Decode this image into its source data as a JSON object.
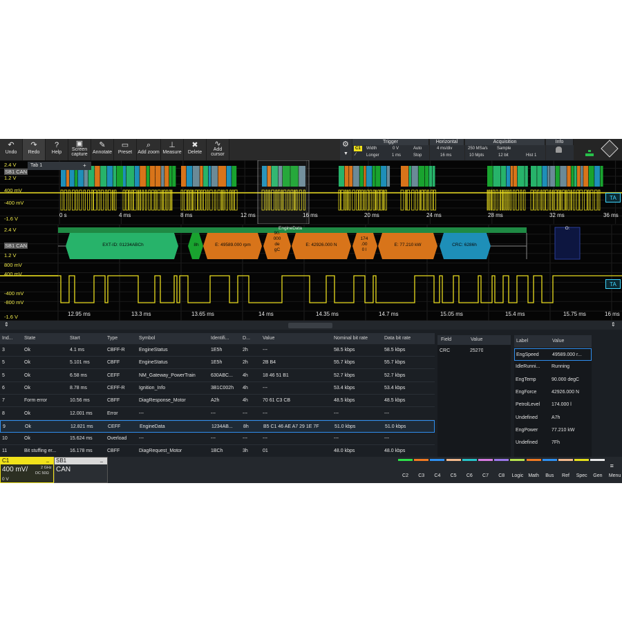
{
  "toolbar": {
    "buttons": [
      {
        "label": "Undo",
        "icon": "undo-icon",
        "glyph": "↶"
      },
      {
        "label": "Redo",
        "icon": "redo-icon",
        "glyph": "↷"
      },
      {
        "label": "Help",
        "icon": "help-icon",
        "glyph": "?"
      },
      {
        "label": "Screen\ncapture",
        "icon": "camera-icon",
        "glyph": "▣"
      },
      {
        "label": "Annotate",
        "icon": "pen-icon",
        "glyph": "✎"
      },
      {
        "label": "Preset",
        "icon": "preset-icon",
        "glyph": "▭"
      },
      {
        "label": "Add zoom",
        "icon": "zoom-icon",
        "glyph": "⌕"
      },
      {
        "label": "Measure",
        "icon": "measure-icon",
        "glyph": "⊥"
      },
      {
        "label": "Delete",
        "icon": "trash-icon",
        "glyph": "✖"
      },
      {
        "label": "Add\ncursor",
        "icon": "cursor-icon",
        "glyph": "∿"
      }
    ],
    "trigger": {
      "title": "Trigger",
      "badge": "C1",
      "row1": [
        "Width",
        "0 V",
        "Auto"
      ],
      "row2": [
        "Longer",
        "1 ms",
        "Stop"
      ]
    },
    "horizontal": {
      "title": "Horizontal",
      "row1": "4 ms/div",
      "row2": "16 ms"
    },
    "acquisition": {
      "title": "Acquisition",
      "row1": [
        "250 MSa/s",
        "Sample"
      ],
      "row2": [
        "10 Mpts",
        "12 bit",
        "Hist 1"
      ]
    },
    "info": {
      "title": "Info"
    }
  },
  "tab": {
    "label": "Tab 1",
    "add": "+"
  },
  "overview": {
    "labels": {
      "v1": "2.4 V",
      "ch": "SB1 CAN",
      "v2": "1.2 V",
      "v3": "400 mV",
      "v4": "-400 mV",
      "v5": "-1.6 V"
    },
    "times": [
      "0 s",
      "4 ms",
      "8 ms",
      "12 ms",
      "16 ms",
      "20 ms",
      "24 ms",
      "28 ms",
      "32 ms",
      "36 ms"
    ],
    "ta": "TA"
  },
  "zoom": {
    "labels": {
      "v1": "2.4 V",
      "ch": "SB1 CAN",
      "v2": "1.2 V",
      "v3": "800 mV",
      "v4": "400 mV",
      "v5": "-400 mV",
      "v6": "-800 mV",
      "v7": "-1.6 V"
    },
    "times": [
      "12.95 ms",
      "13.3 ms",
      "13.65 ms",
      "14 ms",
      "14.35 ms",
      "14.7 ms",
      "15.05 ms",
      "15.4 ms",
      "15.75 ms",
      "16 ms"
    ],
    "frame_title": "EngineData",
    "o_label": "O:",
    "fields": [
      {
        "text": "EXT-ID: 01234ABCh",
        "color": "#27b36a"
      },
      {
        "text": "8h",
        "color": "#19a32f"
      },
      {
        "text": "E: 49589.000 rpm",
        "color": "#d8741a"
      },
      {
        "text": "90.\n000\nde\ngC",
        "color": "#d8741a"
      },
      {
        "text": "E: 42926.000 N",
        "color": "#d8741a"
      },
      {
        "text": "174\n.00\n0 l",
        "color": "#d8741a"
      },
      {
        "text": "E: 77.210 kW",
        "color": "#d8741a"
      },
      {
        "text": "CRC: 6286h",
        "color": "#1e8fb8"
      }
    ],
    "ta": "TA"
  },
  "decode_table": {
    "headers": [
      "Ind...",
      "State",
      "Start",
      "Type",
      "Symbol",
      "Identifi...",
      "D...",
      "Value",
      "Nominal bit rate",
      "Data bit rate"
    ],
    "rows": [
      [
        "3",
        "Ok",
        "4.1 ms",
        "CBFF-R",
        "EngineStatus",
        "1E5h",
        "2h",
        "---",
        "58.5 kbps",
        "58.5 kbps"
      ],
      [
        "5",
        "Ok",
        "5.101 ms",
        "CBFF",
        "EngineStatus",
        "1E5h",
        "2h",
        "2B B4",
        "55.7 kbps",
        "55.7 kbps"
      ],
      [
        "5",
        "Ok",
        "6.58 ms",
        "CEFF",
        "NM_Gateway_PowerTrain",
        "630ABC...",
        "4h",
        "18 46 51 B1",
        "52.7 kbps",
        "52.7 kbps"
      ],
      [
        "6",
        "Ok",
        "8.78 ms",
        "CEFF-R",
        "Ignition_Info",
        "3B1C002h",
        "4h",
        "---",
        "53.4 kbps",
        "53.4 kbps"
      ],
      [
        "7",
        "Form error",
        "10.56 ms",
        "CBFF",
        "DiagResponse_Motor",
        "A2h",
        "4h",
        "70 61 C3 CB",
        "48.5 kbps",
        "48.5 kbps"
      ],
      [
        "8",
        "Ok",
        "12.001 ms",
        "Error",
        "---",
        "---",
        "---",
        "---",
        "---",
        "---"
      ],
      [
        "9",
        "Ok",
        "12.821 ms",
        "CEFF",
        "EngineData",
        "1234AB...",
        "8h",
        "B5 C1 46 AE A7 29 1E 7F",
        "51.0 kbps",
        "51.0 kbps"
      ],
      [
        "10",
        "Ok",
        "15.624 ms",
        "Overload",
        "---",
        "---",
        "---",
        "---",
        "---",
        "---"
      ],
      [
        "11",
        "Bit stuffing er...",
        "16.178 ms",
        "CBFF",
        "DiagRequest_Motor",
        "1BCh",
        "3h",
        "01",
        "48.0 kbps",
        "48.0 kbps"
      ]
    ],
    "selected_index": 6
  },
  "field_table": {
    "headers": [
      "Field",
      "Value"
    ],
    "rows": [
      [
        "CRC",
        "25270"
      ]
    ]
  },
  "label_table": {
    "headers": [
      "Label",
      "Value"
    ],
    "rows": [
      [
        "EngSpeed",
        "49589.000 r..."
      ],
      [
        "IdleRunni...",
        "Running"
      ],
      [
        "EngTemp",
        "90.000 degC"
      ],
      [
        "EngForce",
        "42926.000 N"
      ],
      [
        "PetrolLevel",
        "174.000 l"
      ],
      [
        "Undefined",
        "A7h"
      ],
      [
        "EngPower",
        "77.210 kW"
      ],
      [
        "Undefined",
        "7Fh"
      ]
    ]
  },
  "channel_box": {
    "name": "C1",
    "scale": "400 mV/",
    "bw": "2 GHz",
    "coupling": "DC 50Ω",
    "offset": "0 V"
  },
  "serial_box": {
    "name": "SB1",
    "protocol": "CAN"
  },
  "channel_buttons": [
    {
      "label": "C2",
      "color": "#2ee04a"
    },
    {
      "label": "C3",
      "color": "#f07a22"
    },
    {
      "label": "C4",
      "color": "#2f8ff0"
    },
    {
      "label": "C5",
      "color": "#f2b98c"
    },
    {
      "label": "C6",
      "color": "#27c3c8"
    },
    {
      "label": "C7",
      "color": "#d77be0"
    },
    {
      "label": "C8",
      "color": "#9a77e8"
    },
    {
      "label": "Logic",
      "color": "#b7e24f"
    },
    {
      "label": "Math",
      "color": "#f07a22"
    },
    {
      "label": "Bus",
      "color": "#2f8ff0"
    },
    {
      "label": "Ref",
      "color": "#f2b98c"
    },
    {
      "label": "Spec",
      "color": "#e6e01b"
    },
    {
      "label": "Gen",
      "color": "#e8e8e8"
    },
    {
      "label": "Menu",
      "color": ""
    }
  ]
}
